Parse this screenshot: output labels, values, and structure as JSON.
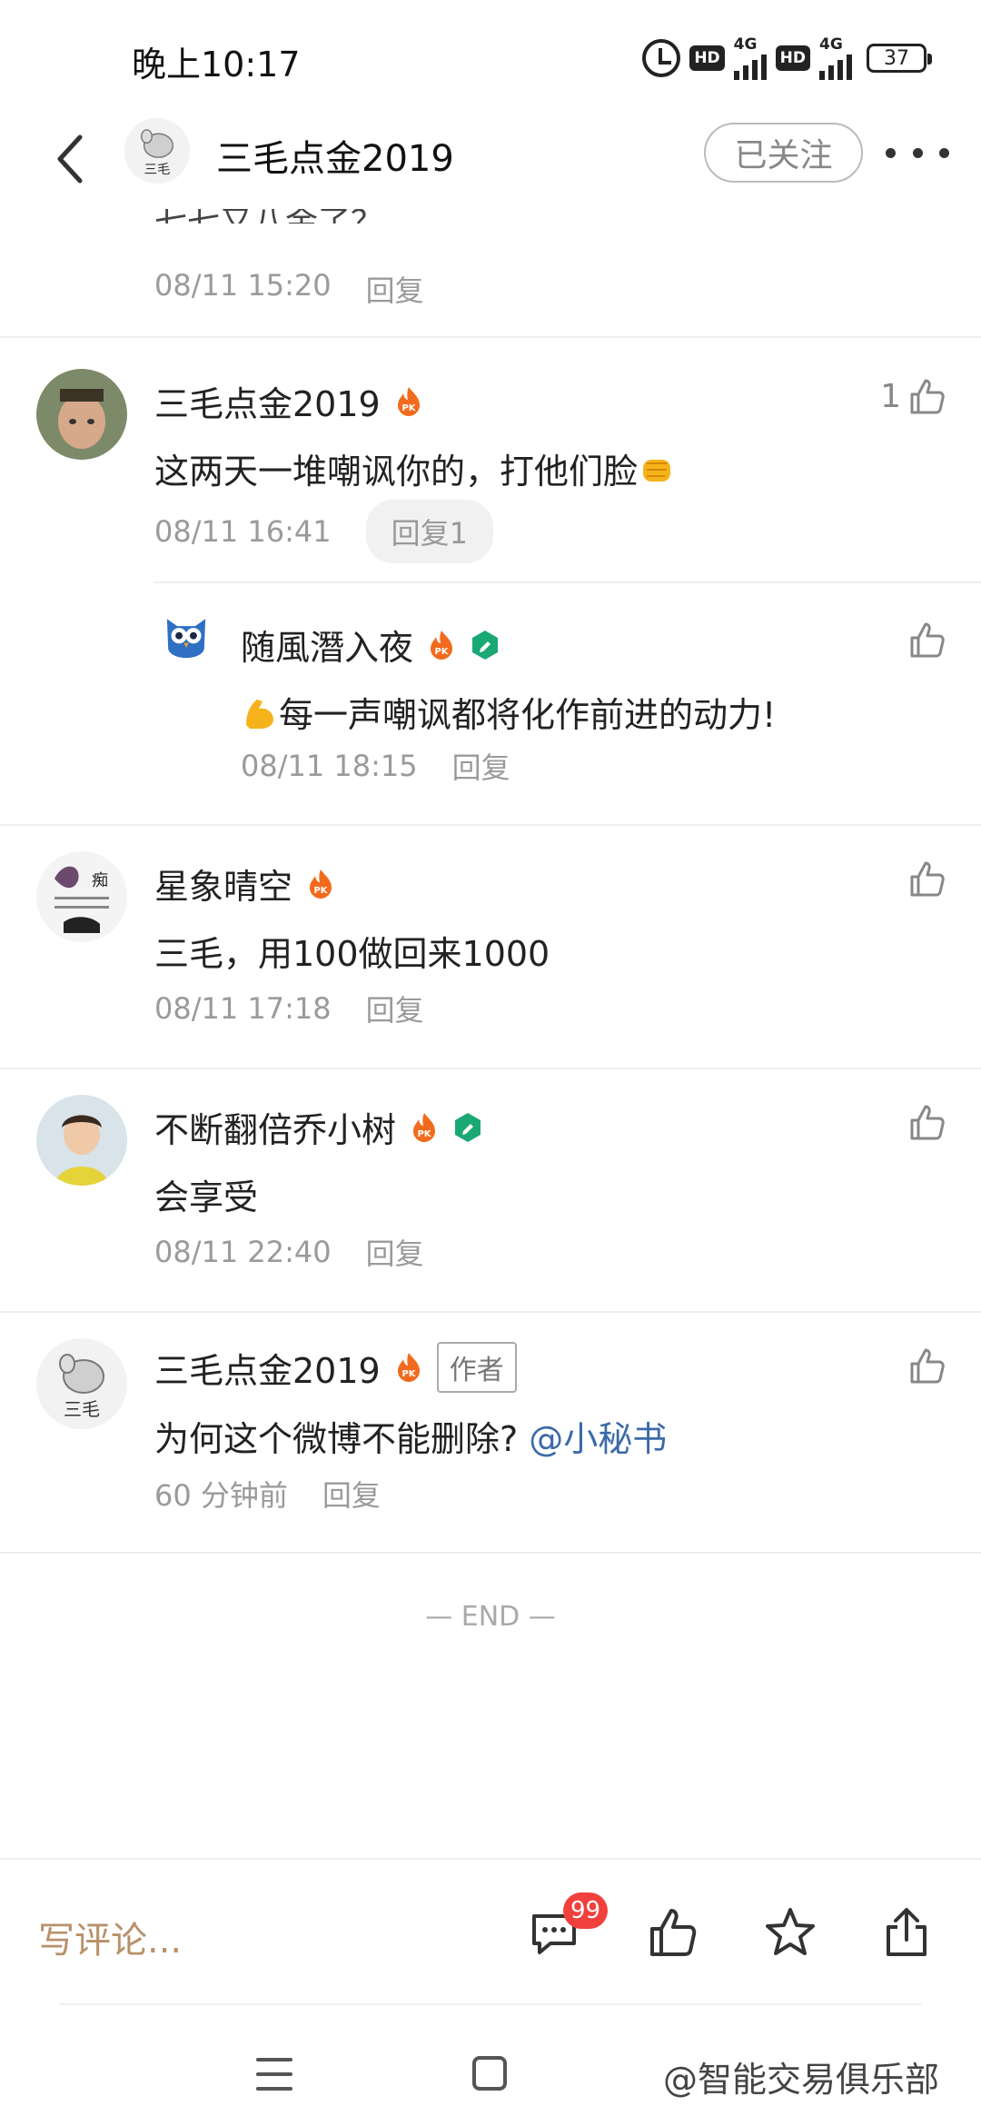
{
  "status_bar": {
    "time": "晚上10:17",
    "hd1": "HD",
    "net1": "4G",
    "hd2": "HD",
    "net2": "4G",
    "battery": "37"
  },
  "header": {
    "title": "三毛点金2019",
    "follow_label": "已关注"
  },
  "partial_comment": {
    "text": "七七又八金了？",
    "time": "08/11 15:20",
    "reply": "回复"
  },
  "comments": [
    {
      "name": "三毛点金2019",
      "text": "这两天一堆嘲讽你的，打他们脸",
      "time": "08/11 16:41",
      "reply": "回复1",
      "likes": "1"
    },
    {
      "name": "随風潛入夜",
      "text": "每一声嘲讽都将化作前进的动力!",
      "time": "08/11 18:15",
      "reply": "回复"
    },
    {
      "name": "星象晴空",
      "text": "三毛，用100做回来1000",
      "time": "08/11 17:18",
      "reply": "回复"
    },
    {
      "name": "不断翻倍乔小树",
      "text": "会享受",
      "time": "08/11 22:40",
      "reply": "回复"
    },
    {
      "name": "三毛点金2019",
      "author_badge": "作者",
      "text": "为何这个微博不能删除?",
      "mention": "@小秘书",
      "time": "60 分钟前",
      "reply": "回复"
    }
  ],
  "end_text": "— END —",
  "bottom_bar": {
    "write_placeholder": "写评论...",
    "comment_count": "99"
  },
  "watermark": "@智能交易俱乐部",
  "colors": {
    "mention": "#3b6aa8",
    "badge_red": "#f2403c",
    "write_text": "#b8906a",
    "pk_orange": "#f26b1d",
    "verified_green": "#1aa874"
  }
}
